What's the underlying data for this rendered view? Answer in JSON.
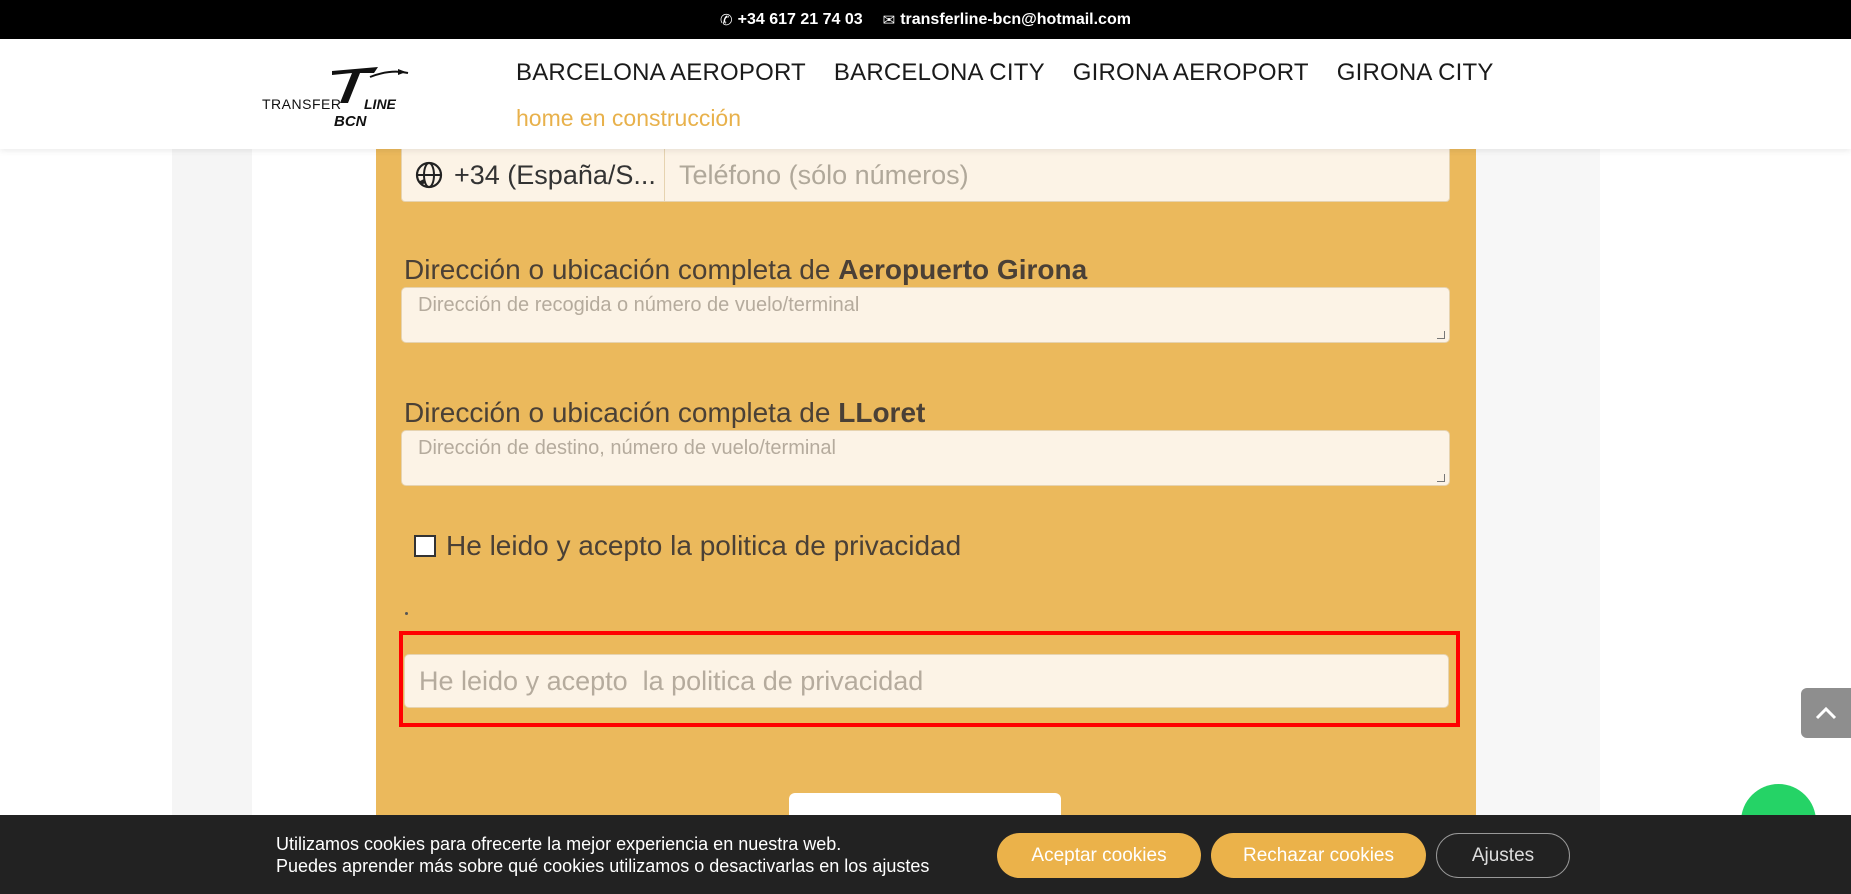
{
  "topbar": {
    "phone": "+34 617 21 74 03",
    "email": "transferline-bcn@hotmail.com"
  },
  "logo": {
    "word1": "TRANSFER",
    "word2": "BCN",
    "word3": "LINE"
  },
  "nav": {
    "items": [
      {
        "label": "BARCELONA AEROPORT"
      },
      {
        "label": "BARCELONA CITY"
      },
      {
        "label": "GIRONA AEROPORT"
      },
      {
        "label": "GIRONA CITY"
      }
    ],
    "sub": "home en construcción"
  },
  "form": {
    "phone_prefix": "+34 (España/S...",
    "phone_placeholder": "Teléfono (sólo números)",
    "pickup_label_prefix": "Dirección o ubicación completa de ",
    "pickup_label_bold": "Aeropuerto Girona",
    "pickup_placeholder": "Dirección de recogida o número de vuelo/terminal",
    "dest_label_prefix": "Dirección o ubicación completa de ",
    "dest_label_bold": "LLoret",
    "dest_placeholder": "Dirección de destino, número de vuelo/terminal",
    "privacy_checkbox_label": "He leido y acepto la politica de privacidad",
    "privacy_input_placeholder": "He leido y acepto  la politica de privacidad"
  },
  "cookies": {
    "line1": "Utilizamos cookies para ofrecerte la mejor experiencia en nuestra web.",
    "line2": "Puedes aprender más sobre qué cookies utilizamos o desactivarlas en los ajustes",
    "accept": "Aceptar cookies",
    "reject": "Rechazar cookies",
    "settings": "Ajustes"
  },
  "colors": {
    "accent": "#ebb95c",
    "nav_sub": "#e8b14b",
    "highlight": "#ff0000"
  }
}
